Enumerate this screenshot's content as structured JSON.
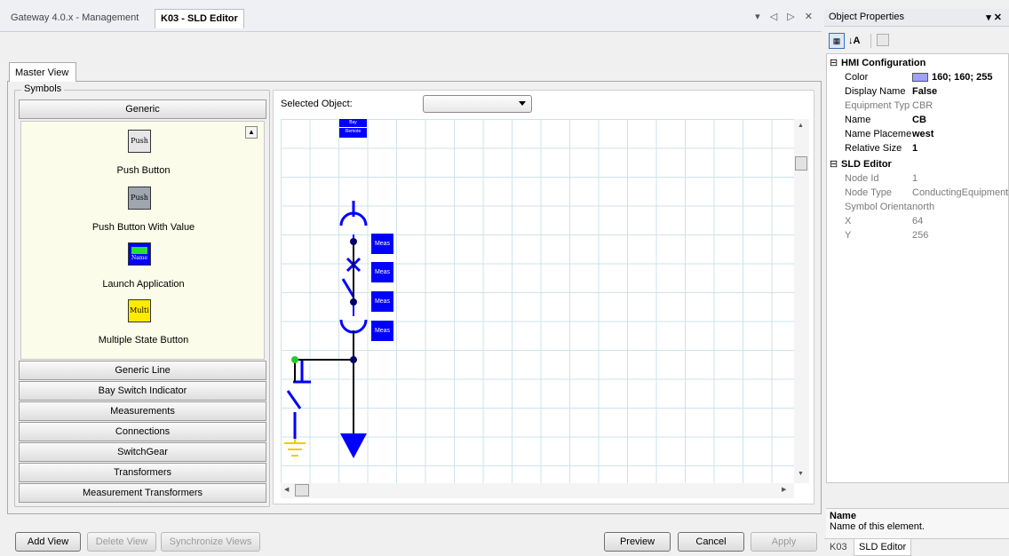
{
  "tabs": [
    {
      "label": "Gateway 4.0.x - Management",
      "active": false
    },
    {
      "label": "K03 - SLD Editor",
      "active": true
    }
  ],
  "tab_controls": "▾ ◁ ▷ ✕",
  "master_tab": "Master View",
  "symbols": {
    "legend": "Symbols",
    "active_category": "Generic",
    "items": [
      {
        "label": "Push Button",
        "icon_text": "Push",
        "icon": "push-button-icon"
      },
      {
        "label": "Push Button With Value",
        "icon_text": "Push",
        "icon": "push-button-value-icon"
      },
      {
        "label": "Launch Application",
        "icon_text": "Name",
        "icon": "launch-application-icon"
      },
      {
        "label": "Multiple State Button",
        "icon_text": "Multi",
        "icon": "multi-state-button-icon"
      }
    ],
    "categories": [
      "Generic Line",
      "Bay Switch Indicator",
      "Measurements",
      "Connections",
      "SwitchGear",
      "Transformers",
      "Measurement Transformers"
    ]
  },
  "canvas": {
    "selected_label": "Selected Object:",
    "selected_value": "",
    "bay_label_top": "Bay",
    "bay_label_bottom": "Remote",
    "meas_labels": [
      "Meas",
      "Meas",
      "Meas",
      "Meas"
    ]
  },
  "buttons": {
    "add_view": "Add View",
    "delete_view": "Delete View",
    "synchronize_views": "Synchronize Views",
    "preview": "Preview",
    "cancel": "Cancel",
    "apply": "Apply"
  },
  "properties": {
    "title": "Object Properties",
    "title_controls": "▾ ✕",
    "categories": [
      {
        "name": "HMI Configuration",
        "rows": [
          {
            "name": "Color",
            "value": "160; 160; 255",
            "bold": true,
            "gray": false,
            "swatch": "#a0a0ff"
          },
          {
            "name": "Display Name",
            "value": "False",
            "bold": true,
            "gray": false
          },
          {
            "name": "Equipment Typ",
            "value": "CBR",
            "bold": false,
            "gray": true
          },
          {
            "name": "Name",
            "value": "CB",
            "bold": true,
            "gray": false
          },
          {
            "name": "Name Placeme",
            "value": "west",
            "bold": true,
            "gray": false
          },
          {
            "name": "Relative Size",
            "value": "1",
            "bold": true,
            "gray": false
          }
        ]
      },
      {
        "name": "SLD Editor",
        "rows": [
          {
            "name": "Node Id",
            "value": "1",
            "bold": false,
            "gray": true
          },
          {
            "name": "Node Type",
            "value": "ConductingEquipment",
            "bold": false,
            "gray": true
          },
          {
            "name": "Symbol Orienta",
            "value": "north",
            "bold": false,
            "gray": true
          },
          {
            "name": "X",
            "value": "64",
            "bold": false,
            "gray": true
          },
          {
            "name": "Y",
            "value": "256",
            "bold": false,
            "gray": true
          }
        ]
      }
    ],
    "description_title": "Name",
    "description_text": "Name of this element.",
    "bottom_tabs": [
      "K03",
      "SLD Editor"
    ]
  },
  "colors": {
    "accent_blue": "#0000ff",
    "panel_yellow": "#fcfcea"
  }
}
